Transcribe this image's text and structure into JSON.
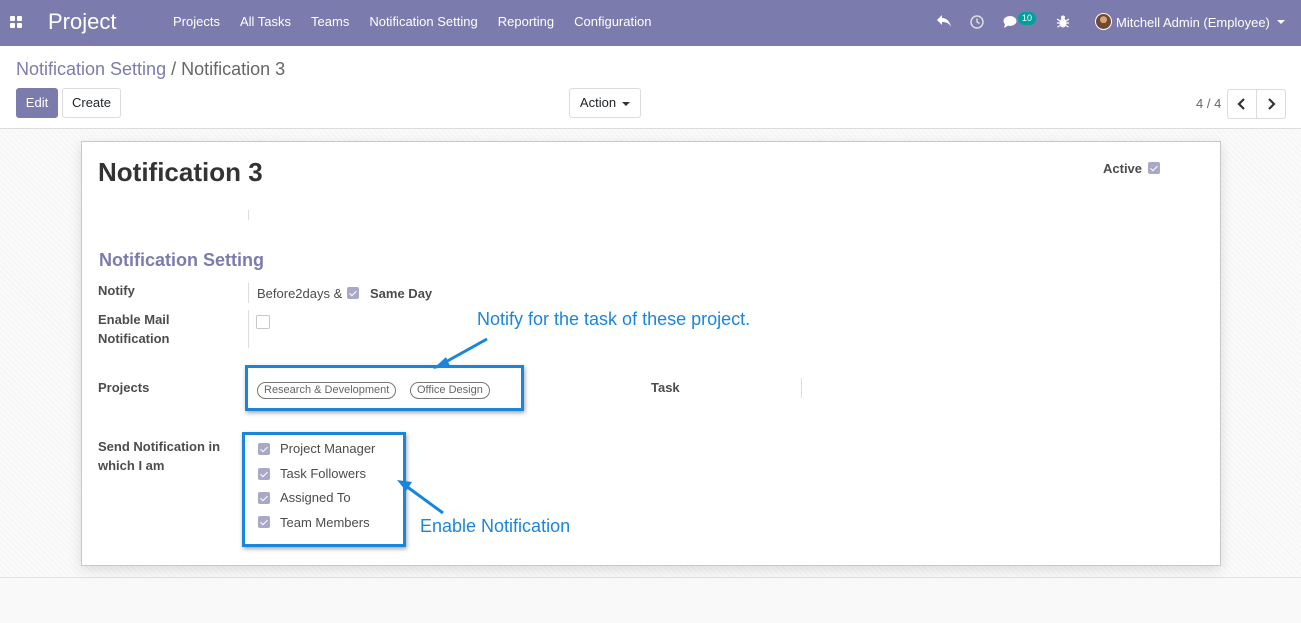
{
  "navbar": {
    "brand": "Project",
    "menu": [
      "Projects",
      "All Tasks",
      "Teams",
      "Notification Setting",
      "Reporting",
      "Configuration"
    ],
    "messages_count": "10",
    "user": "Mitchell Admin (Employee)",
    "icons": [
      "apps-icon",
      "undo-icon",
      "clock-icon",
      "chat-icon",
      "bug-icon"
    ]
  },
  "breadcrumb": {
    "parent": "Notification Setting",
    "separator": " / ",
    "current": "Notification 3"
  },
  "buttons": {
    "edit": "Edit",
    "create": "Create",
    "action": "Action"
  },
  "pager": {
    "value": "4 / 4"
  },
  "form": {
    "title": "Notification 3",
    "active_label": "Active",
    "active": true,
    "section_title": "Notification Setting",
    "notify_label": "Notify",
    "notify_value": "Before2days &",
    "notify_before_checked": true,
    "same_day_label": "Same Day",
    "enable_mail_label": "Enable Mail Notification",
    "enable_mail_checked": false,
    "projects_label": "Projects",
    "projects": [
      "Research & Development",
      "Office Design"
    ],
    "task_label": "Task",
    "send_label": "Send Notification in which I am",
    "send_options": [
      {
        "label": "Project Manager",
        "checked": true
      },
      {
        "label": "Task Followers",
        "checked": true
      },
      {
        "label": "Assigned To",
        "checked": true
      },
      {
        "label": "Team Members",
        "checked": true
      }
    ]
  },
  "annotations": {
    "projects_note": "Notify for the task of these project.",
    "send_note": "Enable Notification"
  },
  "colors": {
    "navbar": "#7c7bad",
    "accent": "#7c7bad",
    "annotation": "#1a86db"
  }
}
